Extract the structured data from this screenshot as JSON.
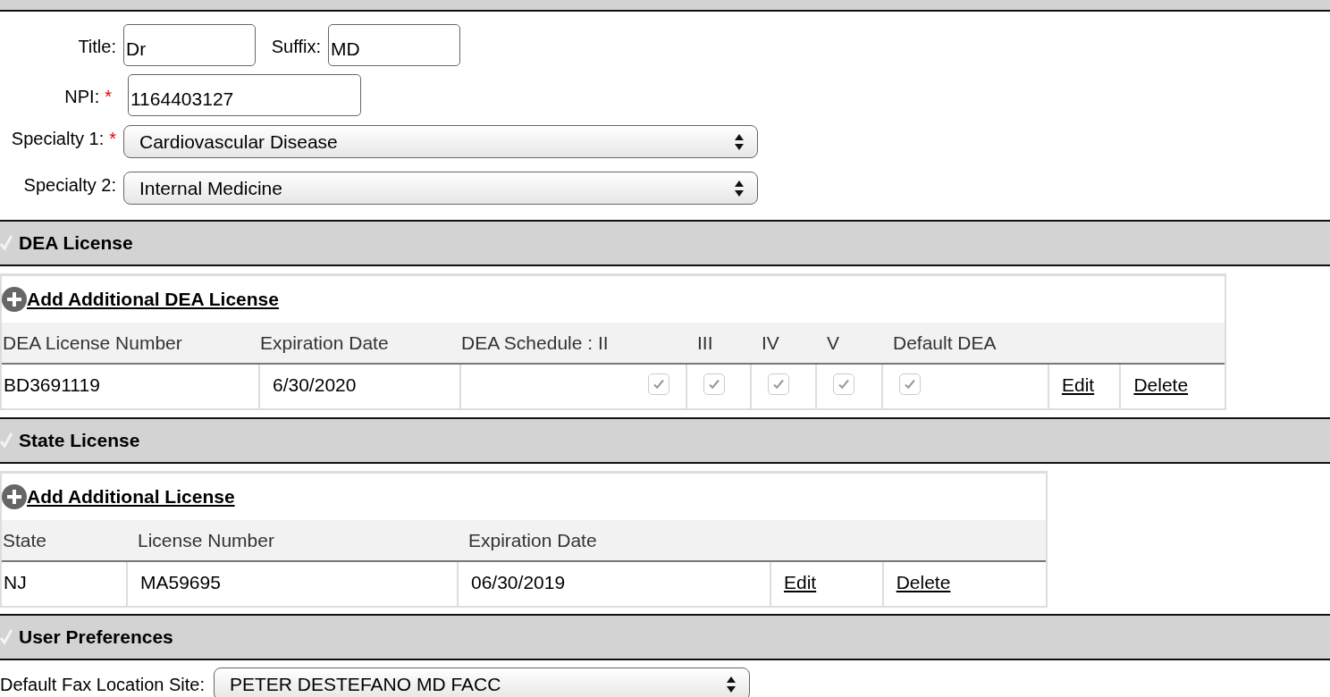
{
  "name_fields": [
    {
      "label": "Title:",
      "value": "Dr"
    },
    {
      "label": "Suffix:",
      "value": "MD"
    }
  ],
  "npi": {
    "label": "NPI:",
    "required_mark": "*",
    "value": "1164403127"
  },
  "specialties": [
    {
      "label": "Specialty 1:",
      "required_mark": "*",
      "value": "Cardiovascular Disease"
    },
    {
      "label": "Specialty 2:",
      "value": "Internal Medicine"
    }
  ],
  "dea_section": {
    "title": "DEA License",
    "add_link": "Add Additional DEA License",
    "columns": [
      "DEA License Number",
      "Expiration Date",
      "DEA Schedule : II",
      "III",
      "IV",
      "V",
      "Default DEA"
    ],
    "rows": [
      {
        "number": "BD3691119",
        "expiration": "6/30/2020",
        "checks": [
          {
            "checked": true,
            "disabled": true
          },
          {
            "checked": true,
            "disabled": true
          },
          {
            "checked": true,
            "disabled": true
          },
          {
            "checked": true,
            "disabled": true
          },
          {
            "checked": true,
            "disabled": true
          }
        ],
        "edit": "Edit",
        "delete": "Delete"
      }
    ]
  },
  "state_section": {
    "title": "State License",
    "add_link": "Add Additional License",
    "columns": [
      "State",
      "License Number",
      "Expiration Date"
    ],
    "rows": [
      {
        "state": "NJ",
        "number": "MA59695",
        "expiration": "06/30/2019",
        "edit": "Edit",
        "delete": "Delete"
      }
    ]
  },
  "preferences_section": {
    "title": "User Preferences",
    "fax_label": "Default Fax Location Site:",
    "fax_value": "PETER DESTEFANO MD FACC"
  }
}
